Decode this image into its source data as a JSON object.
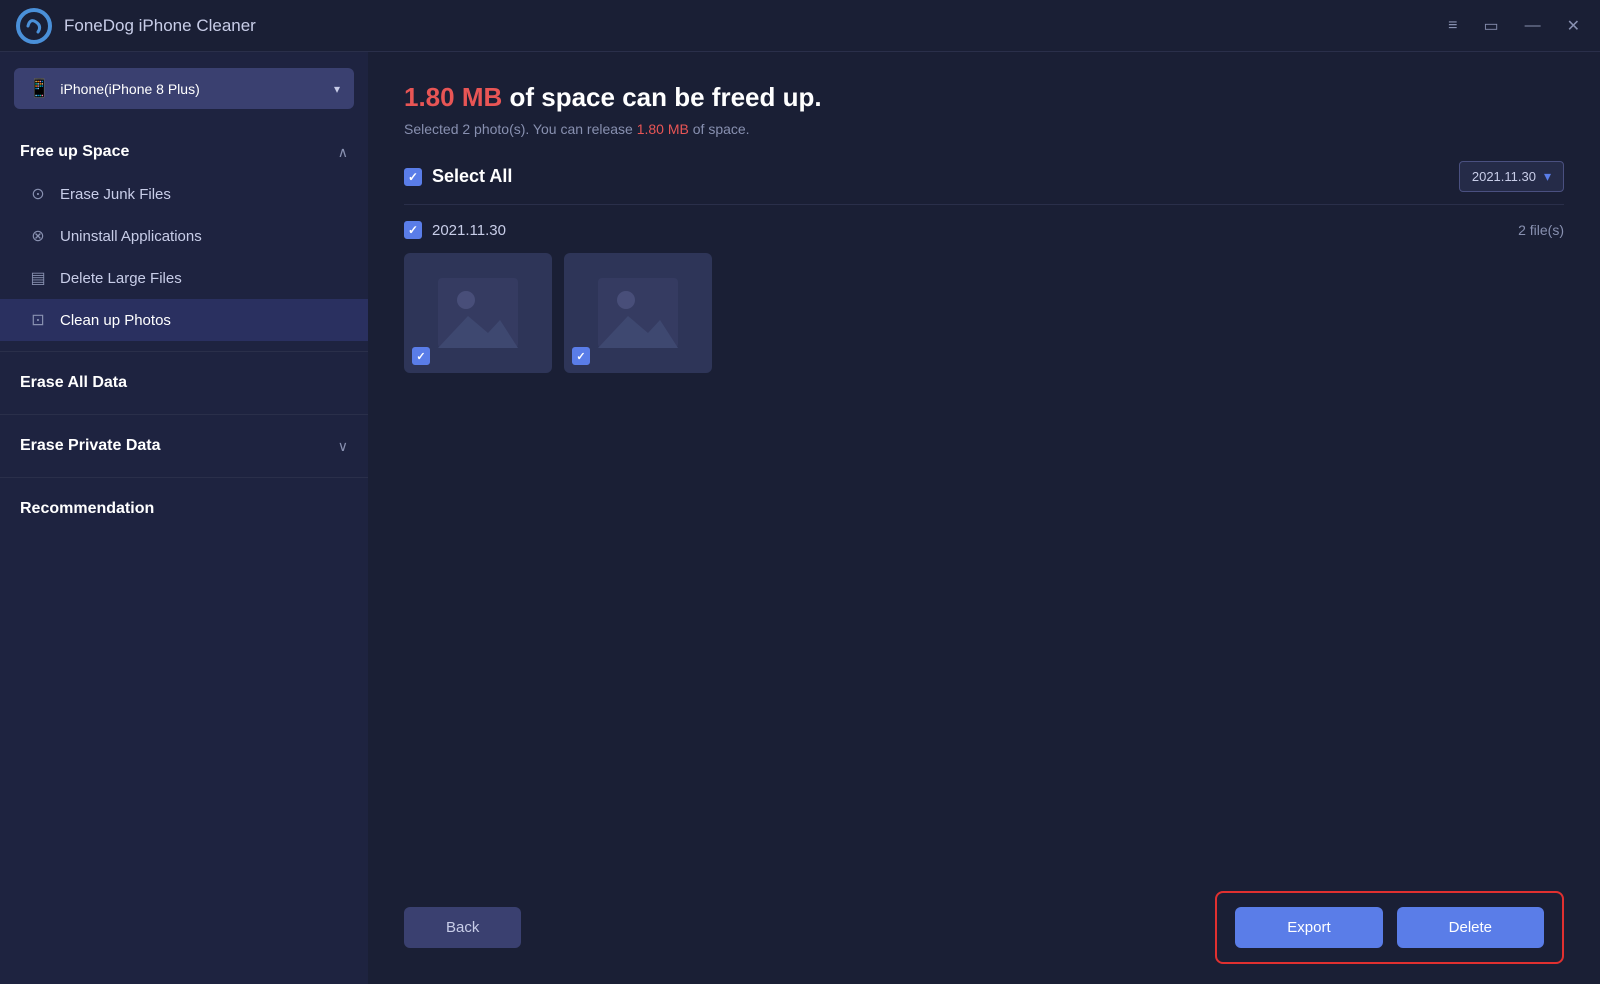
{
  "app": {
    "title": "FoneDog iPhone Cleaner"
  },
  "titlebar": {
    "menu_icon": "≡",
    "chat_icon": "▭",
    "minimize_icon": "—",
    "close_icon": "✕"
  },
  "device": {
    "label": "iPhone(iPhone 8 Plus)"
  },
  "sidebar": {
    "free_up_space": {
      "title": "Free up Space",
      "expanded": true,
      "items": [
        {
          "id": "erase-junk-files",
          "label": "Erase Junk Files",
          "icon": "⊙"
        },
        {
          "id": "uninstall-applications",
          "label": "Uninstall Applications",
          "icon": "⊗"
        },
        {
          "id": "delete-large-files",
          "label": "Delete Large Files",
          "icon": "▤"
        },
        {
          "id": "clean-up-photos",
          "label": "Clean up Photos",
          "icon": "⊡",
          "active": true
        }
      ]
    },
    "erase_all_data": {
      "title": "Erase All Data"
    },
    "erase_private_data": {
      "title": "Erase Private Data",
      "has_arrow": true
    },
    "recommendation": {
      "title": "Recommendation"
    }
  },
  "content": {
    "size_highlight": "1.80 MB",
    "title_text": " of space can be freed up.",
    "subtitle_prefix": "Selected 2 photo(s). You can release ",
    "subtitle_size": "1.80 MB",
    "subtitle_suffix": " of space.",
    "select_all_label": "Select All",
    "date_dropdown": "2021.11.30",
    "photo_group": {
      "date": "2021.11.30",
      "count": "2 file(s)",
      "photos": [
        {
          "id": "photo-1",
          "checked": true
        },
        {
          "id": "photo-2",
          "checked": true
        }
      ]
    }
  },
  "buttons": {
    "back": "Back",
    "export": "Export",
    "delete": "Delete"
  }
}
